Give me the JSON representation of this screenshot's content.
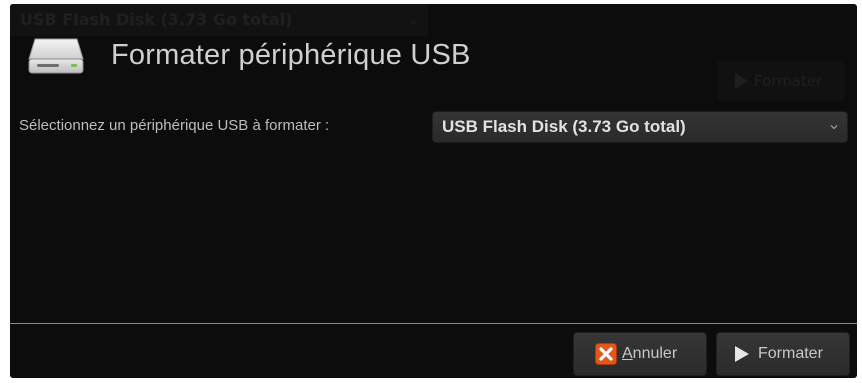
{
  "ghost": {
    "combo_text": "USB Flash Disk (3.73 Go total)",
    "button_text": "Formater"
  },
  "header": {
    "title": "Formater périphérique USB",
    "icon": "usb-drive-icon"
  },
  "device_select": {
    "label": "Sélectionnez un périphérique USB à formater :",
    "selected_value": "USB Flash Disk (3.73 Go total)",
    "arrow_icon": "chevron-down-icon"
  },
  "buttons": {
    "cancel": {
      "mnemonic": "A",
      "rest": "nnuler",
      "icon": "close-x-icon",
      "icon_color": "#e2571c"
    },
    "format": {
      "label": "Formater",
      "icon": "play-icon"
    }
  },
  "colors": {
    "background": "#0c0c0c",
    "text": "#c7c7c7",
    "title": "#cfcfcf",
    "button": "#303030"
  }
}
